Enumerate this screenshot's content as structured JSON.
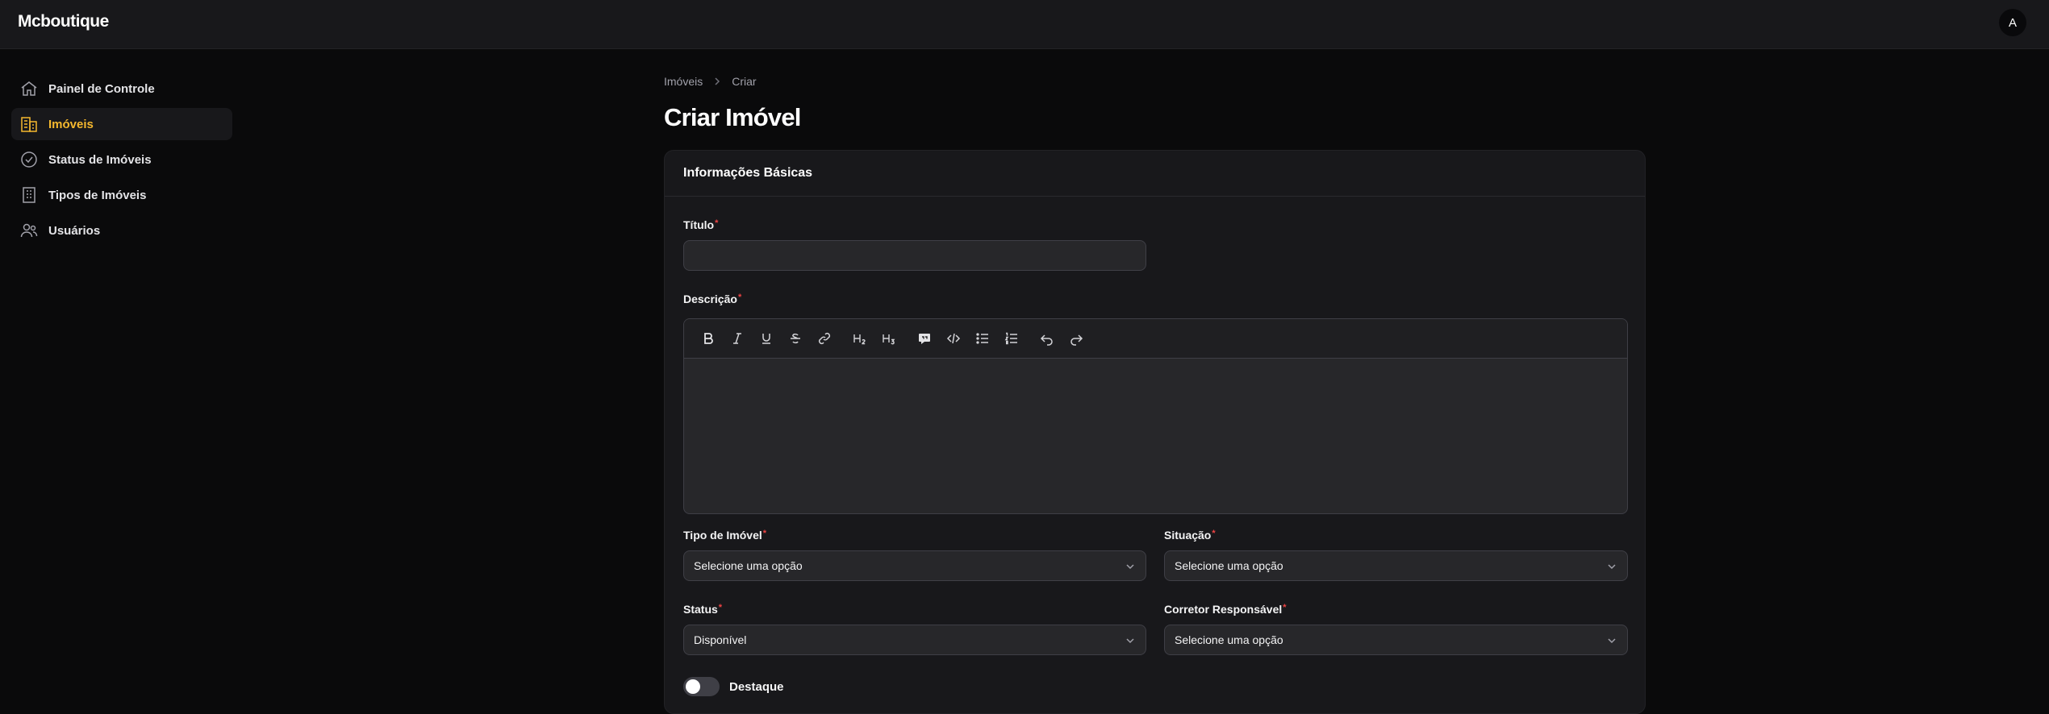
{
  "app": {
    "brand": "Mcboutique",
    "avatar_initial": "A"
  },
  "colors": {
    "accent": "#f5b82e",
    "required": "#ef4444",
    "background": "#0a0a0b",
    "surface": "#18181b"
  },
  "sidebar": {
    "items": [
      {
        "label": "Painel de Controle",
        "icon": "home-icon",
        "active": false
      },
      {
        "label": "Imóveis",
        "icon": "building-icon",
        "active": true
      },
      {
        "label": "Status de Imóveis",
        "icon": "check-circle-icon",
        "active": false
      },
      {
        "label": "Tipos de Imóveis",
        "icon": "office-building-icon",
        "active": false
      },
      {
        "label": "Usuários",
        "icon": "users-icon",
        "active": false
      }
    ]
  },
  "breadcrumb": {
    "parent": "Imóveis",
    "current": "Criar"
  },
  "page": {
    "title": "Criar Imóvel"
  },
  "form": {
    "section_title": "Informações Básicas",
    "titulo": {
      "label": "Título",
      "value": ""
    },
    "descricao": {
      "label": "Descrição"
    },
    "toolbar": [
      "bold",
      "italic",
      "underline",
      "strikethrough",
      "link",
      "H2",
      "H3",
      "blockquote",
      "code-block",
      "bullet-list",
      "ordered-list",
      "undo",
      "redo"
    ],
    "tipo": {
      "label": "Tipo de Imóvel",
      "value": "Selecione uma opção"
    },
    "situacao": {
      "label": "Situação",
      "value": "Selecione uma opção"
    },
    "status": {
      "label": "Status",
      "value": "Disponível"
    },
    "corretor": {
      "label": "Corretor Responsável",
      "value": "Selecione uma opção"
    },
    "destaque": {
      "label": "Destaque",
      "enabled": false
    }
  }
}
